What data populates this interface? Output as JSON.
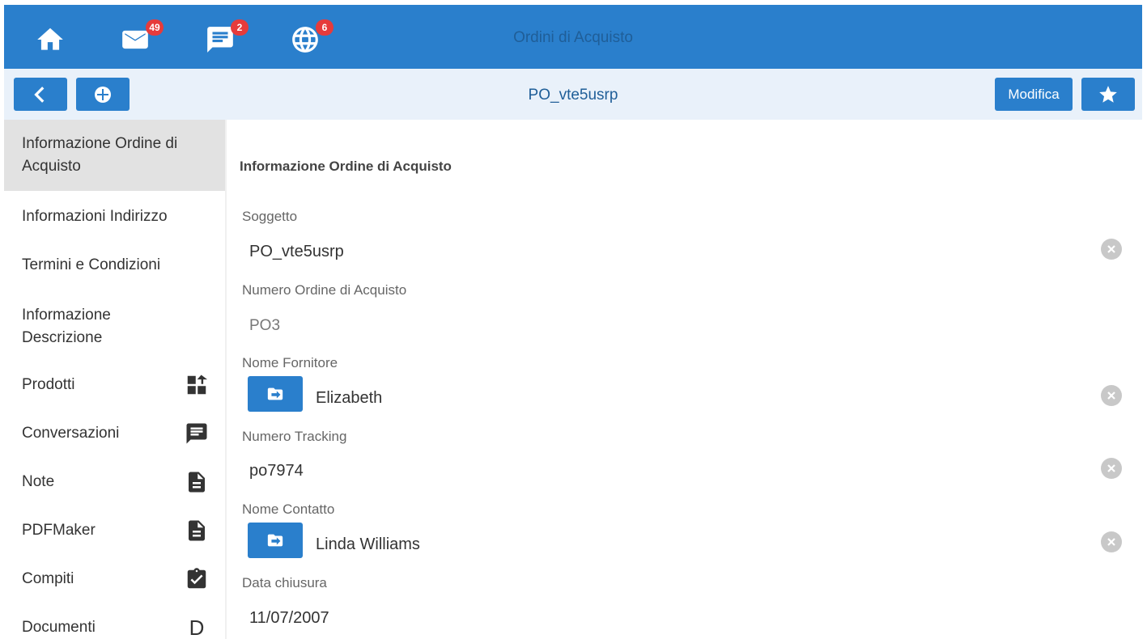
{
  "header": {
    "title": "Ordini di Acquisto",
    "icons": [
      {
        "name": "home-icon"
      },
      {
        "name": "mail-icon",
        "badge": "49"
      },
      {
        "name": "chat-icon",
        "badge": "2"
      },
      {
        "name": "globe-icon",
        "badge": "6"
      }
    ]
  },
  "toolbar": {
    "record_title": "PO_vte5usrp",
    "edit_label": "Modifica"
  },
  "sidebar": {
    "items": [
      {
        "label": "Informazione Ordine di Acquisto",
        "active": true
      },
      {
        "label": "Informazioni Indirizzo"
      },
      {
        "label": "Termini e Condizioni"
      },
      {
        "label": "Informazione Descrizione"
      },
      {
        "label": "Prodotti",
        "icon": "products-icon"
      },
      {
        "label": "Conversazioni",
        "icon": "comment-icon"
      },
      {
        "label": "Note",
        "icon": "document-icon"
      },
      {
        "label": "PDFMaker",
        "icon": "document-icon"
      },
      {
        "label": "Compiti",
        "icon": "task-icon"
      },
      {
        "label": "Documenti",
        "icon": "D"
      }
    ]
  },
  "form": {
    "section_title": "Informazione Ordine di Acquisto",
    "fields": [
      {
        "label": "Soggetto",
        "value": "PO_vte5usrp"
      },
      {
        "label": "Numero Ordine di Acquisto",
        "value": "PO3"
      },
      {
        "label": "Nome Fornitore",
        "value": "Elizabeth"
      },
      {
        "label": "Numero Tracking",
        "value": "po7974"
      },
      {
        "label": "Nome Contatto",
        "value": "Linda Williams"
      },
      {
        "label": "Data chiusura",
        "value": "11/07/2007"
      }
    ]
  },
  "colors": {
    "primary": "#2a7fcc",
    "toolbar_bg": "#e9f1fa",
    "badge": "#e63b3b",
    "active_item": "#e2e2e2"
  }
}
